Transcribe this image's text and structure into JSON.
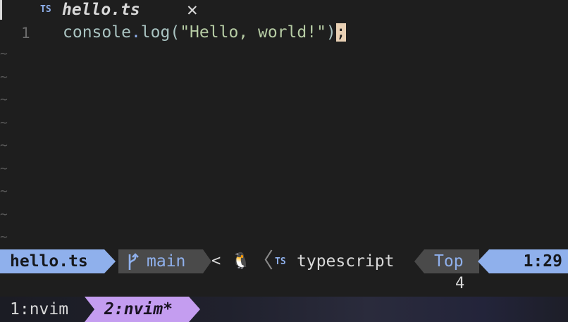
{
  "tabline": {
    "filetype_icon": "TS",
    "filename": "hello.ts",
    "close_glyph": "✕"
  },
  "buffer": {
    "line_number": "1",
    "code": {
      "object": "console",
      "dot": ".",
      "method": "log",
      "open_paren": "(",
      "string": "\"Hello, world!\"",
      "close_paren": ")",
      "cursor_char": ";"
    },
    "empty_line_marker": "~"
  },
  "statusline": {
    "filename": "hello.ts",
    "branch_icon": "git-branch-icon",
    "branch": "main",
    "lt": "<",
    "os_icon": "🐧",
    "separator": "〈",
    "filetype_icon": "TS",
    "filetype": "typescript",
    "position": "Top",
    "location": "1:29"
  },
  "cmdline": {
    "count": "4"
  },
  "tmux": {
    "window1": "1:nvim",
    "window2": "2:nvim*"
  },
  "colors": {
    "background": "#1e1e1e",
    "accent_blue": "#8fb0ec",
    "segment_gray": "#4a4a4a",
    "tmux_active": "#c49df0",
    "cursor": "#e8d0b4"
  }
}
